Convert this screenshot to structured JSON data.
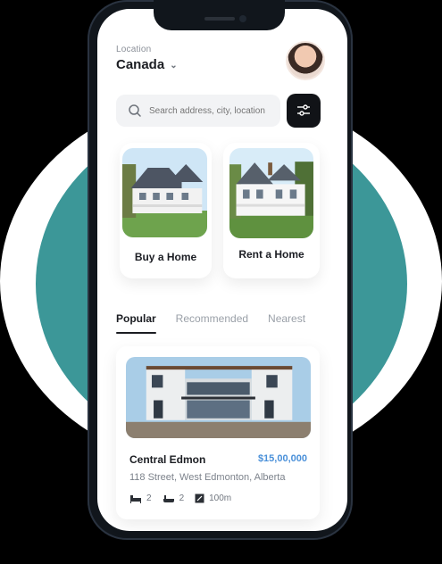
{
  "location": {
    "label": "Location",
    "value": "Canada"
  },
  "search": {
    "placeholder": "Search address, city, location"
  },
  "categories": [
    {
      "label": "Buy a Home"
    },
    {
      "label": "Rent a Home"
    }
  ],
  "tabs": [
    "Popular",
    "Recommended",
    "Nearest"
  ],
  "property": {
    "name": "Central Edmon",
    "price": "$15,00,000",
    "address": "118 Street, West Edmonton, Alberta",
    "beds": "2",
    "baths": "2",
    "area": "100m"
  },
  "icons": {
    "search": "search-icon",
    "filter": "filter-icon",
    "chevron": "chevron-down-icon",
    "bed": "bed-icon",
    "bath": "bath-icon",
    "area": "area-icon"
  },
  "colors": {
    "background": "#000000",
    "teal": "#3c9798",
    "price": "#4a90d9",
    "dark_button": "#111317"
  }
}
